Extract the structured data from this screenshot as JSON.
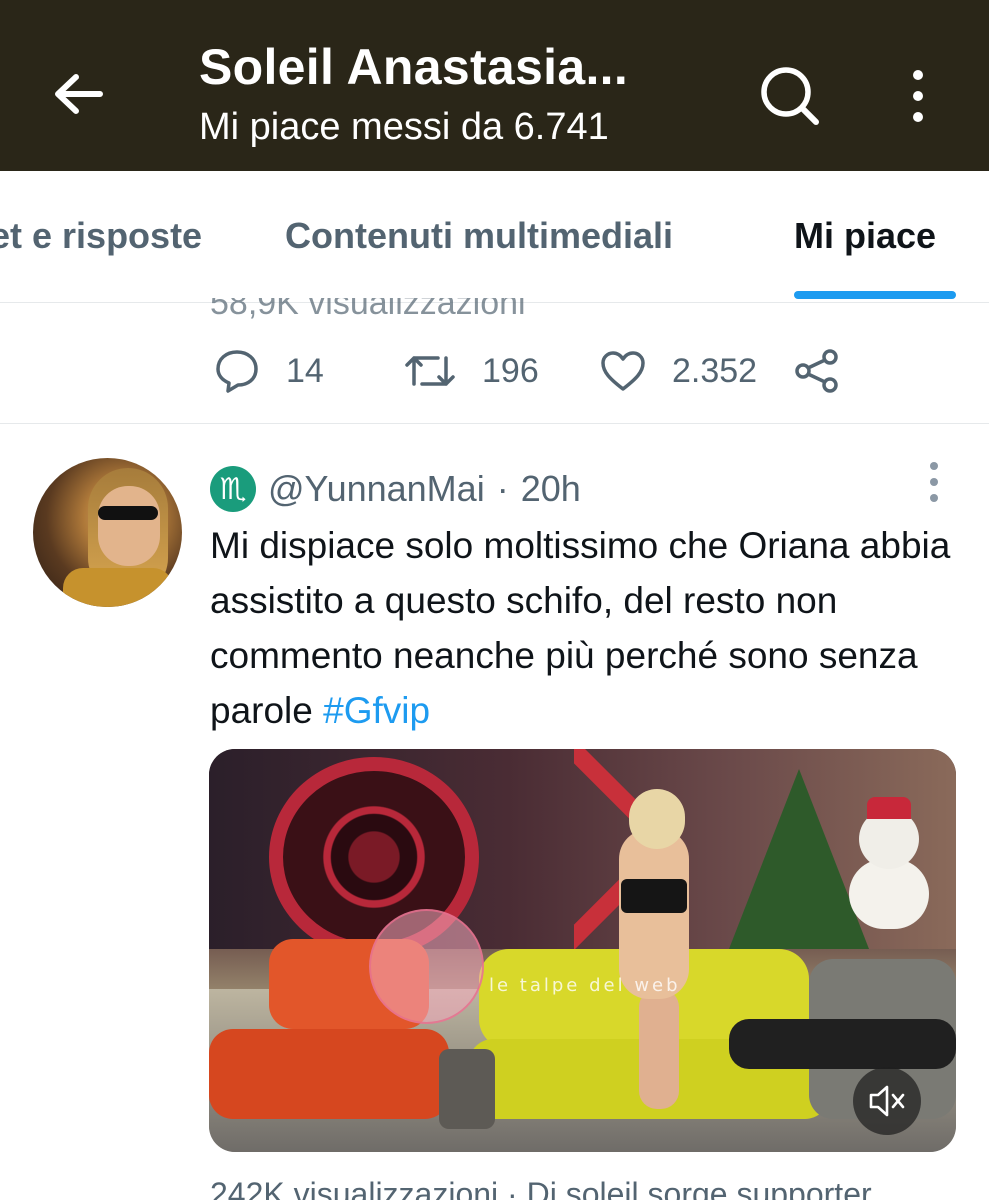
{
  "header": {
    "title": "Soleil Anastasia...",
    "subtitle": "Mi piace messi da 6.741",
    "back_icon": "arrow-left-icon",
    "search_icon": "search-icon",
    "more_icon": "more-vertical-icon",
    "background_color": "#2a2618"
  },
  "tabs": [
    {
      "label": "et e risposte",
      "active": false
    },
    {
      "label": "Contenuti multimediali",
      "active": false
    },
    {
      "label": "Mi piace",
      "active": true
    }
  ],
  "accent_color": "#1d9bf0",
  "previous_tweet": {
    "partial_text": "58,9K visualizzazioni",
    "replies": "14",
    "retweets": "196",
    "likes": "2.352"
  },
  "tweet": {
    "handle": "@YunnanMai",
    "separator": "·",
    "time": "20h",
    "badge_glyph": "♏",
    "text": "Mi dispiace solo moltissimo che Oriana abbia assistito a questo schifo, del resto non commento neanche più perché sono senza parole ",
    "hashtag": "#Gfvip",
    "media_watermark": "le talpe del web",
    "mute_icon": "volume-muted-icon"
  },
  "footer_partial": "242K visualizzazioni · Di soleil sorge supporter"
}
